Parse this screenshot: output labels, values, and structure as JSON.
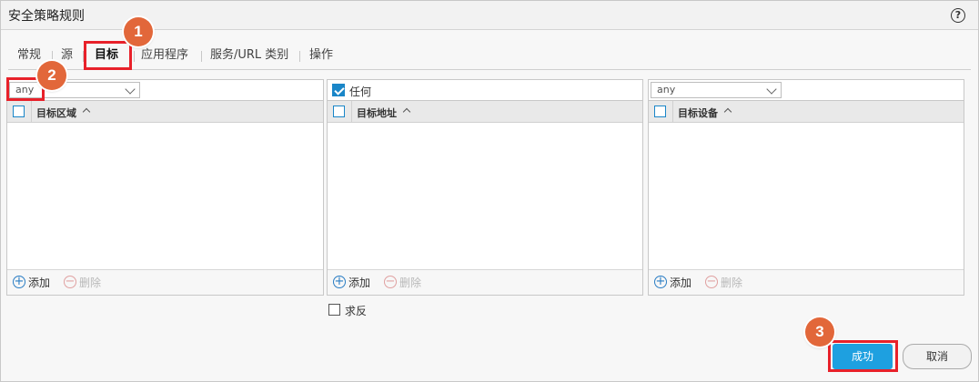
{
  "window": {
    "title": "安全策略规则",
    "help_label": "?"
  },
  "tabs": [
    {
      "label": "常规"
    },
    {
      "label": "源"
    },
    {
      "label": "目标",
      "active": true
    },
    {
      "label": "应用程序"
    },
    {
      "label": "服务/URL 类别"
    },
    {
      "label": "操作"
    }
  ],
  "zone_panel": {
    "dropdown_value": "any",
    "column_header": "目标区域",
    "add_label": "添加",
    "delete_label": "删除"
  },
  "address_panel": {
    "any_checkbox_label": "任何",
    "any_checked": true,
    "column_header": "目标地址",
    "add_label": "添加",
    "delete_label": "删除"
  },
  "device_panel": {
    "dropdown_value": "any",
    "column_header": "目标设备",
    "add_label": "添加",
    "delete_label": "删除"
  },
  "negate": {
    "label": "求反",
    "checked": false
  },
  "buttons": {
    "ok_label": "成功",
    "cancel_label": "取消"
  },
  "callouts": [
    "1",
    "2",
    "3"
  ],
  "icons": {
    "add": "plus-circle-icon",
    "delete": "minus-circle-icon",
    "help": "help-icon"
  },
  "colors": {
    "accent": "#1ea0e0",
    "callout_badge": "#e2673a",
    "callout_outline": "#e8212a"
  }
}
